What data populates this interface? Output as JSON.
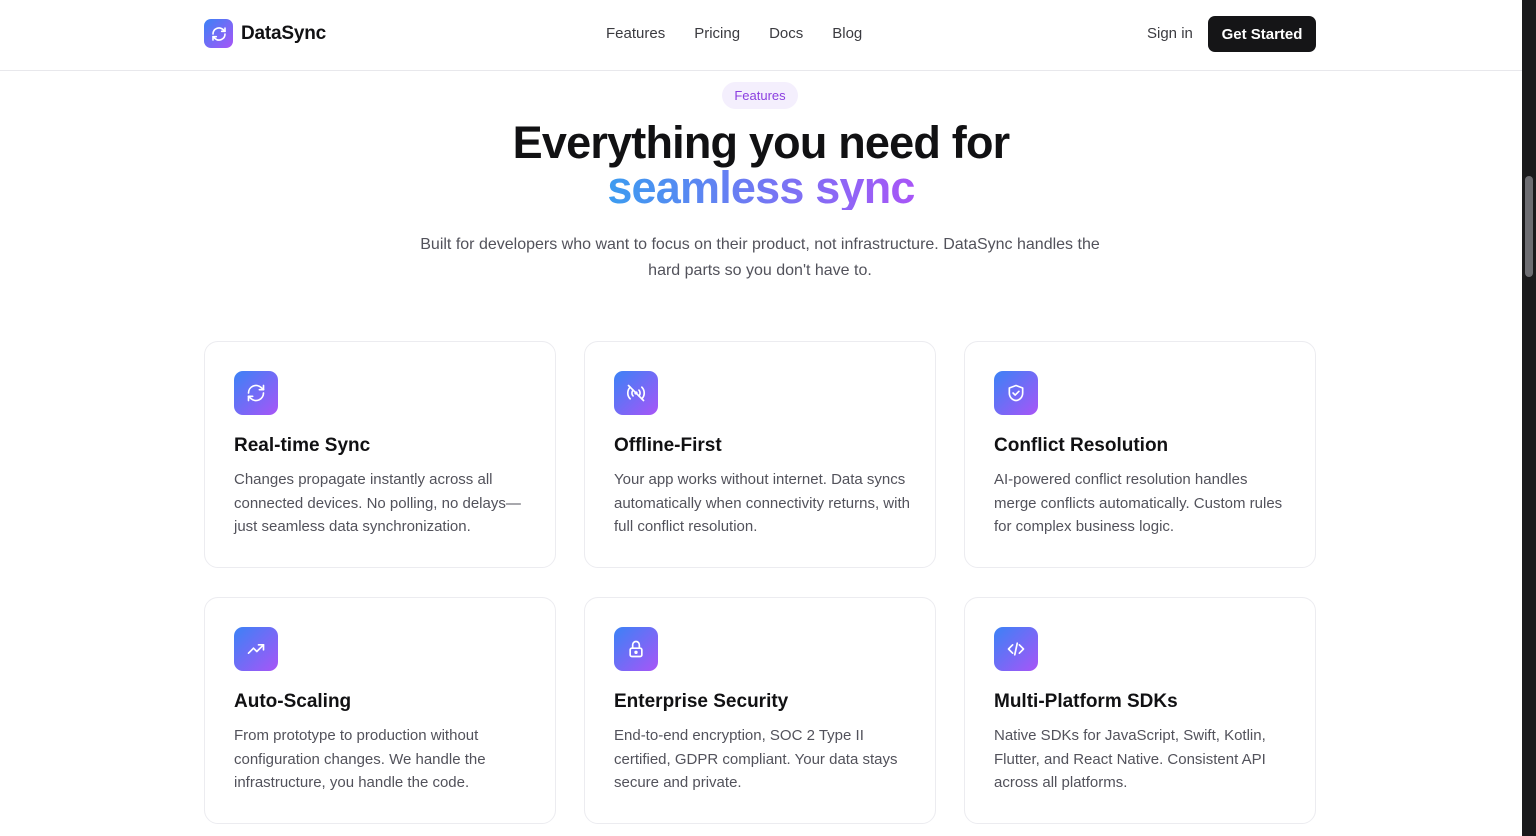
{
  "brand": {
    "name": "DataSync",
    "icon": "refresh-icon"
  },
  "nav": {
    "items": [
      {
        "label": "Features"
      },
      {
        "label": "Pricing"
      },
      {
        "label": "Docs"
      },
      {
        "label": "Blog"
      }
    ],
    "sign_in": "Sign in",
    "cta": "Get Started"
  },
  "hero": {
    "badge": "Features",
    "headline_line1": "Everything you need for",
    "headline_line2": "seamless sync",
    "subtitle": "Built for developers who want to focus on their product, not infrastructure. DataSync handles the hard parts so you don't have to."
  },
  "features": [
    {
      "icon": "refresh-icon",
      "title": "Real-time Sync",
      "description": "Changes propagate instantly across all connected devices. No polling, no delays—just seamless data synchronization."
    },
    {
      "icon": "wifi-off-icon",
      "title": "Offline-First",
      "description": "Your app works without internet. Data syncs automatically when connectivity returns, with full conflict resolution."
    },
    {
      "icon": "shield-check-icon",
      "title": "Conflict Resolution",
      "description": "AI-powered conflict resolution handles merge conflicts automatically. Custom rules for complex business logic."
    },
    {
      "icon": "trending-up-icon",
      "title": "Auto-Scaling",
      "description": "From prototype to production without configuration changes. We handle the infrastructure, you handle the code."
    },
    {
      "icon": "lock-icon",
      "title": "Enterprise Security",
      "description": "End-to-end encryption, SOC 2 Type II certified, GDPR compliant. Your data stays secure and private."
    },
    {
      "icon": "code-icon",
      "title": "Multi-Platform SDKs",
      "description": "Native SDKs for JavaScript, Swift, Kotlin, Flutter, and React Native. Consistent API across all platforms."
    }
  ],
  "colors": {
    "accent_start": "#3b82f6",
    "accent_end": "#a855f7",
    "cta_bg": "#151517",
    "badge_bg": "#f4effd",
    "badge_text": "#8b3fe0"
  }
}
